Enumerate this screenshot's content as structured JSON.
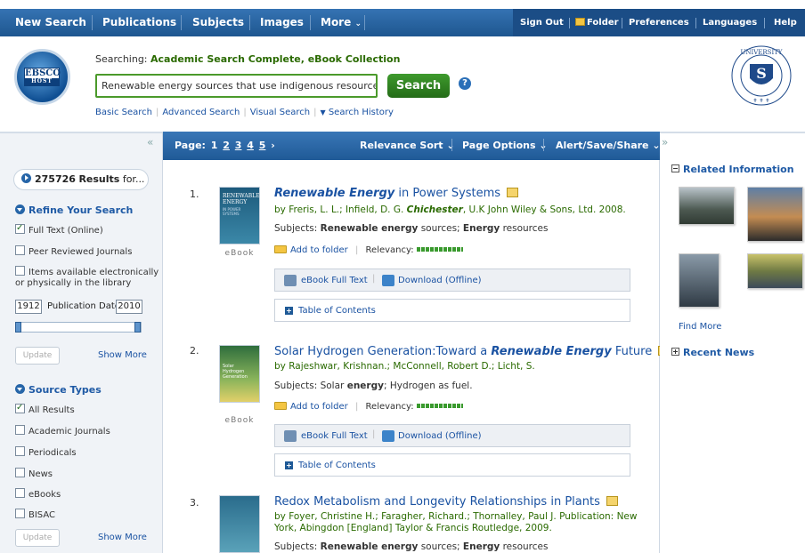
{
  "nav": {
    "items": [
      "New Search",
      "Publications",
      "Subjects",
      "Images",
      "More"
    ],
    "right_items": [
      "Sign Out",
      "Folder",
      "Preferences",
      "Languages",
      "Help"
    ]
  },
  "header": {
    "logo_text": "EBSCO",
    "logo_sub": "HOST",
    "searching_label": "Searching:",
    "searching_dbs": "Academic Search Complete, eBook Collection",
    "search_value": "Renewable energy sources that use indigenous resources h",
    "search_button": "Search",
    "help_glyph": "?",
    "links": [
      "Basic Search",
      "Advanced Search",
      "Visual Search",
      "Search History"
    ]
  },
  "left": {
    "collapse_glyph": "«",
    "results_count": "275726",
    "results_label": "Results",
    "results_suffix": "for...",
    "refine_heading": "Refine Your Search",
    "refine_options": [
      {
        "label": "Full Text (Online)",
        "checked": true
      },
      {
        "label": "Peer Reviewed Journals",
        "checked": false
      },
      {
        "label": "Items available electronically",
        "label2": "or physically in the library",
        "checked": false
      }
    ],
    "date_from": "1912",
    "date_label": "Publication Dates",
    "date_to": "2010",
    "update_label": "Update",
    "show_more": "Show More",
    "source_heading": "Source Types",
    "source_options": [
      {
        "label": "All Results",
        "checked": true
      },
      {
        "label": "Academic Journals",
        "checked": false
      },
      {
        "label": "Periodicals",
        "checked": false
      },
      {
        "label": "News",
        "checked": false
      },
      {
        "label": "eBooks",
        "checked": false
      },
      {
        "label": "BISAC",
        "checked": false
      }
    ]
  },
  "main": {
    "page_label": "Page:",
    "pages": [
      "1",
      "2",
      "3",
      "4",
      "5"
    ],
    "page_next": "›",
    "relevance": "Relevance Sort",
    "page_options": "Page Options",
    "alert": "Alert/Save/Share",
    "results": [
      {
        "num": "1.",
        "title_pre": "",
        "title_em": "Renewable Energy",
        "title_post": " in Power Systems",
        "byline_pre": "by Freris, L. L.; Infield, D. G. ",
        "byline_em": "Chichester",
        "byline_post": ", U.K John Wiley & Sons, Ltd. 2008.",
        "subjects_pre": "Subjects: ",
        "subjects_b1": "Renewable energy",
        "subjects_mid": " sources; ",
        "subjects_b2": "Energy",
        "subjects_post": " resources",
        "type": "eBook",
        "cover_text": "RENEWABLE ENERGY",
        "cover_sub": "IN POWER SYSTEMS"
      },
      {
        "num": "2.",
        "title_pre": "Solar Hydrogen Generation:Toward a ",
        "title_em": "Renewable Energy",
        "title_post": " Future",
        "byline": "by Rajeshwar, Krishnan.; McConnell, Robert D.; Licht, S.",
        "subjects_pre": "Subjects: Solar ",
        "subjects_b1": "energy",
        "subjects_post": "; Hydrogen as fuel.",
        "type": "eBook",
        "cover_text": "Solar Hydrogen Generation"
      },
      {
        "num": "3.",
        "title": "Redox Metabolism and Longevity Relationships in Plants",
        "byline1": "by Foyer, Christine H.; Faragher, Richard.; Thornalley, Paul J.  Publication: New",
        "byline2": "York, Abingdon [England] Taylor & Francis Routledge, 2009.",
        "subjects_pre": "Subjects: ",
        "subjects_b1": "Renewable energy",
        "subjects_mid": " sources; ",
        "subjects_b2": "Energy",
        "subjects_post": " resources"
      }
    ],
    "add_to_folder": "Add to folder",
    "relevancy": "Relevancy:",
    "ebook_full_text": "eBook Full Text",
    "download": "Download (Offline)",
    "toc": "Table of Contents"
  },
  "right": {
    "collapse_glyph": "»",
    "related": "Related Information",
    "find_more": "Find More",
    "recent_news": "Recent News"
  },
  "colors": {
    "nav_blue": "#1e568f",
    "accent_green": "#2a6a00",
    "link_blue": "#1a52a2"
  }
}
